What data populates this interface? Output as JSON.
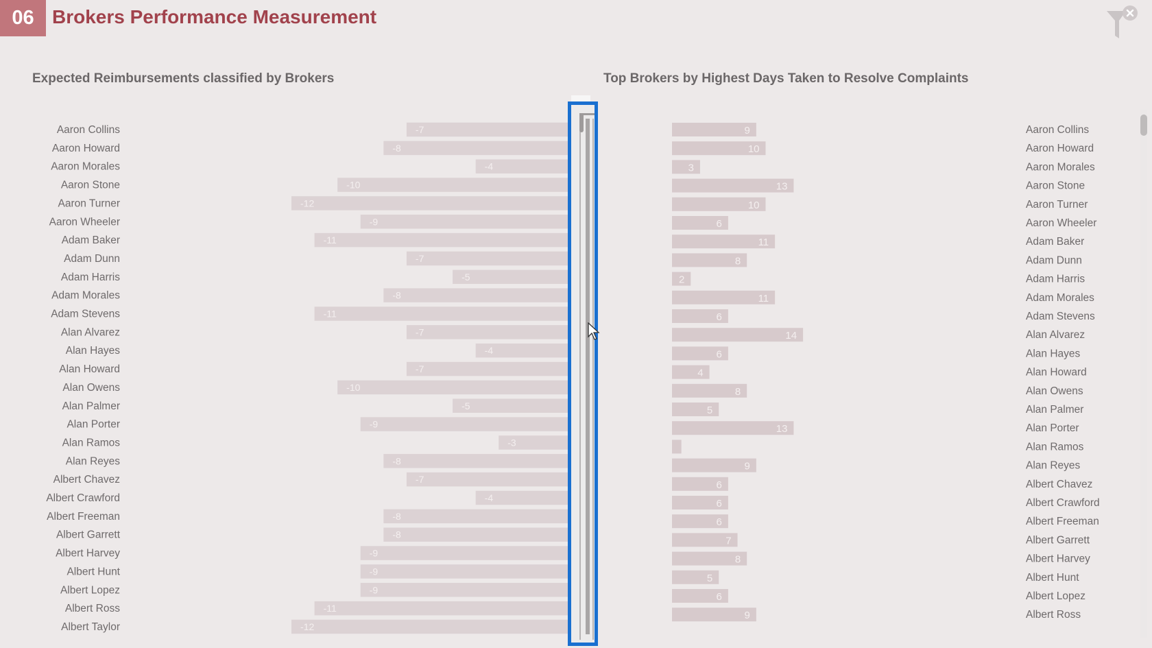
{
  "header": {
    "page_number": "06",
    "title": "Brokers Performance Measurement",
    "filter_icon": "clear-filter-icon"
  },
  "colors": {
    "accent": "#c1767c",
    "title": "#a1424c",
    "bar_left": "#dcd2d4",
    "bar_right": "#d7cacc",
    "selection_outline": "#1a70d0"
  },
  "chart_data": [
    {
      "type": "bar",
      "orientation": "horizontal",
      "title": "Expected Reimbursements classified by Brokers",
      "xlabel": "",
      "ylabel": "",
      "xlim": [
        -12,
        0
      ],
      "grid": false,
      "data_labels": true,
      "categories": [
        "Aaron Collins",
        "Aaron Howard",
        "Aaron Morales",
        "Aaron Stone",
        "Aaron Turner",
        "Aaron Wheeler",
        "Adam Baker",
        "Adam Dunn",
        "Adam Harris",
        "Adam Morales",
        "Adam Stevens",
        "Alan Alvarez",
        "Alan Hayes",
        "Alan Howard",
        "Alan Owens",
        "Alan Palmer",
        "Alan Porter",
        "Alan Ramos",
        "Alan Reyes",
        "Albert Chavez",
        "Albert Crawford",
        "Albert Freeman",
        "Albert Garrett",
        "Albert Harvey",
        "Albert Hunt",
        "Albert Lopez",
        "Albert Ross",
        "Albert Taylor"
      ],
      "values": [
        -7,
        -8,
        -4,
        -10,
        -12,
        -9,
        -11,
        -7,
        -5,
        -8,
        -11,
        -7,
        -4,
        -7,
        -10,
        -5,
        -9,
        -3,
        -8,
        -7,
        -4,
        -8,
        -8,
        -9,
        -9,
        -9,
        -11,
        -12
      ]
    },
    {
      "type": "bar",
      "orientation": "horizontal",
      "title": "Top Brokers by Highest Days Taken to Resolve Complaints",
      "xlabel": "",
      "ylabel": "",
      "xlim": [
        0,
        14
      ],
      "grid": false,
      "data_labels": true,
      "categories": [
        "Aaron Collins",
        "Aaron Howard",
        "Aaron Morales",
        "Aaron Stone",
        "Aaron Turner",
        "Aaron Wheeler",
        "Adam Baker",
        "Adam Dunn",
        "Adam Harris",
        "Adam Morales",
        "Adam Stevens",
        "Alan Alvarez",
        "Alan Hayes",
        "Alan Howard",
        "Alan Owens",
        "Alan Palmer",
        "Alan Porter",
        "Alan Ramos",
        "Alan Reyes",
        "Albert Chavez",
        "Albert Crawford",
        "Albert Freeman",
        "Albert Garrett",
        "Albert Harvey",
        "Albert Hunt",
        "Albert Lopez",
        "Albert Ross"
      ],
      "values": [
        9,
        10,
        3,
        13,
        10,
        6,
        11,
        8,
        2,
        11,
        6,
        14,
        6,
        4,
        8,
        5,
        13,
        1,
        9,
        6,
        6,
        6,
        7,
        8,
        5,
        6,
        9
      ]
    }
  ]
}
